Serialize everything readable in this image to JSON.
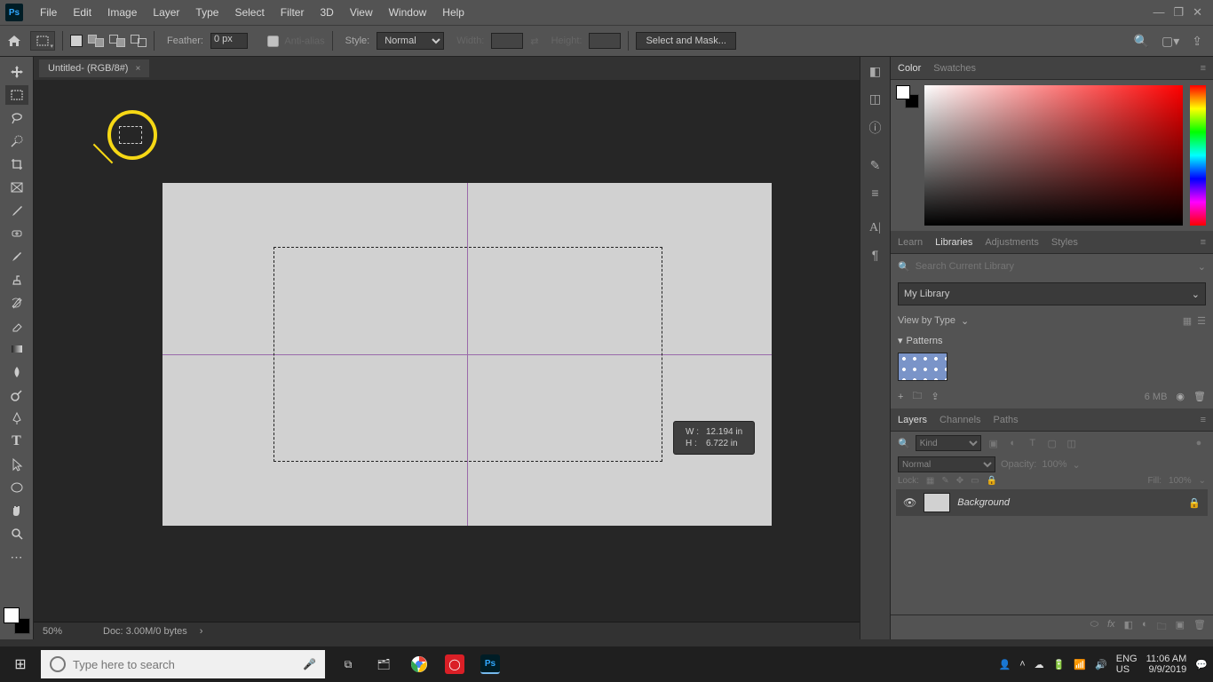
{
  "menu": {
    "items": [
      "File",
      "Edit",
      "Image",
      "Layer",
      "Type",
      "Select",
      "Filter",
      "3D",
      "View",
      "Window",
      "Help"
    ]
  },
  "options": {
    "feather_label": "Feather:",
    "feather_value": "0 px",
    "antialias": "Anti-alias",
    "style_label": "Style:",
    "style_value": "Normal",
    "width_label": "Width:",
    "height_label": "Height:",
    "selectmask": "Select and Mask..."
  },
  "tab": {
    "title": "Untitled-     (RGB/8#)",
    "close": "×"
  },
  "dim": {
    "w_label": "W :",
    "w": "12.194 in",
    "h_label": "H :",
    "h": "6.722 in"
  },
  "status": {
    "zoom": "50%",
    "doc": "Doc: 3.00M/0 bytes"
  },
  "color_tabs": {
    "a": "Color",
    "b": "Swatches"
  },
  "lib_tabs": {
    "a": "Learn",
    "b": "Libraries",
    "c": "Adjustments",
    "d": "Styles"
  },
  "lib": {
    "search_placeholder": "Search Current Library",
    "select": "My Library",
    "view": "View by Type",
    "group": "Patterns",
    "size": "6 MB"
  },
  "layer_tabs": {
    "a": "Layers",
    "b": "Channels",
    "c": "Paths"
  },
  "layers": {
    "kind": "Kind",
    "mode": "Normal",
    "opacity_label": "Opacity:",
    "opacity": "100%",
    "lock_label": "Lock:",
    "fill_label": "Fill:",
    "fill": "100%",
    "bgname": "Background"
  },
  "taskbar": {
    "search_placeholder": "Type here to search",
    "lang1": "ENG",
    "lang2": "US",
    "time": "11:06 AM",
    "date": "9/9/2019"
  }
}
